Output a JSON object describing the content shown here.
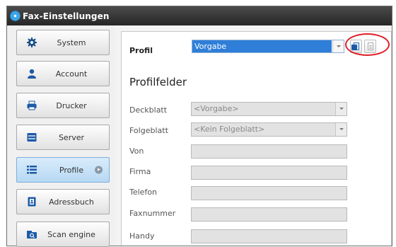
{
  "window": {
    "title": "Fax-Einstellungen"
  },
  "sidebar": {
    "items": [
      {
        "label": "System",
        "icon": "gear-icon",
        "active": false
      },
      {
        "label": "Account",
        "icon": "user-icon",
        "active": false
      },
      {
        "label": "Drucker",
        "icon": "printer-icon",
        "active": false
      },
      {
        "label": "Server",
        "icon": "server-icon",
        "active": false
      },
      {
        "label": "Profile",
        "icon": "list-icon",
        "active": true
      },
      {
        "label": "Adressbuch",
        "icon": "address-book-icon",
        "active": false
      },
      {
        "label": "Scan engine",
        "icon": "scanner-icon",
        "active": false
      }
    ]
  },
  "profile": {
    "label": "Profil",
    "selected": "Vorgabe",
    "new_button_icon": "new-profile-icon",
    "copy_button_icon": "copy-profile-icon",
    "highlight_color": "#e0202a"
  },
  "fields": {
    "title": "Profilfelder",
    "deckblatt": {
      "label": "Deckblatt",
      "value": "<Vorgabe>"
    },
    "folgeblatt": {
      "label": "Folgeblatt",
      "value": "<Kein Folgeblatt>"
    },
    "von": {
      "label": "Von",
      "value": ""
    },
    "firma": {
      "label": "Firma",
      "value": ""
    },
    "telefon": {
      "label": "Telefon",
      "value": ""
    },
    "faxnummer": {
      "label": "Faxnummer",
      "value": ""
    },
    "handy": {
      "label": "Handy",
      "value": ""
    }
  },
  "colors": {
    "accent": "#2f7fd8",
    "titlebar": "#333333"
  }
}
